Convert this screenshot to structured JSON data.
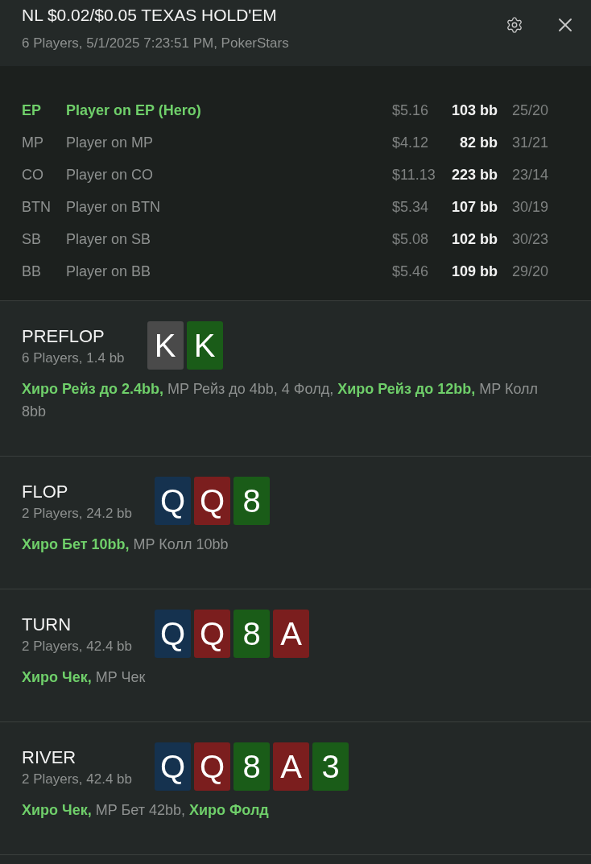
{
  "header": {
    "title": "NL $0.02/$0.05 TEXAS HOLD'EM",
    "subtitle": "6 Players, 5/1/2025 7:23:51 PM, PokerStars"
  },
  "players": [
    {
      "position": "EP",
      "name": "Player on EP (Hero)",
      "stack": "$5.16",
      "stack_bb": "103 bb",
      "stats": "25/20",
      "hero": true
    },
    {
      "position": "MP",
      "name": "Player on MP",
      "stack": "$4.12",
      "stack_bb": "82 bb",
      "stats": "31/21",
      "hero": false
    },
    {
      "position": "CO",
      "name": "Player on CO",
      "stack": "$11.13",
      "stack_bb": "223 bb",
      "stats": "23/14",
      "hero": false
    },
    {
      "position": "BTN",
      "name": "Player on BTN",
      "stack": "$5.34",
      "stack_bb": "107 bb",
      "stats": "30/19",
      "hero": false
    },
    {
      "position": "SB",
      "name": "Player on SB",
      "stack": "$5.08",
      "stack_bb": "102 bb",
      "stats": "30/23",
      "hero": false
    },
    {
      "position": "BB",
      "name": "Player on BB",
      "stack": "$5.46",
      "stack_bb": "109 bb",
      "stats": "29/20",
      "hero": false
    }
  ],
  "streets": [
    {
      "name": "PREFLOP",
      "info": "6 Players, 1.4 bb",
      "cards": [
        {
          "rank": "K",
          "color": "#4a4a4a"
        },
        {
          "rank": "K",
          "color": "#1a5c18"
        }
      ],
      "actions": "**Хиро Рейз до 2.4bb,** MP Рейз до 4bb, 4 Фолд, **Хиро Рейз до 12bb,** MP Колл 8bb"
    },
    {
      "name": "FLOP",
      "info": "2 Players, 24.2 bb",
      "cards": [
        {
          "rank": "Q",
          "color": "#15324f"
        },
        {
          "rank": "Q",
          "color": "#7b1e1e"
        },
        {
          "rank": "8",
          "color": "#1a5c18"
        }
      ],
      "actions": "**Хиро Бет 10bb,** MP Колл 10bb"
    },
    {
      "name": "TURN",
      "info": "2 Players, 42.4 bb",
      "cards": [
        {
          "rank": "Q",
          "color": "#15324f"
        },
        {
          "rank": "Q",
          "color": "#7b1e1e"
        },
        {
          "rank": "8",
          "color": "#1a5c18"
        },
        {
          "rank": "A",
          "color": "#7b1e1e"
        }
      ],
      "actions": "**Хиро Чек,** MP Чек"
    },
    {
      "name": "RIVER",
      "info": "2 Players, 42.4 bb",
      "cards": [
        {
          "rank": "Q",
          "color": "#15324f"
        },
        {
          "rank": "Q",
          "color": "#7b1e1e"
        },
        {
          "rank": "8",
          "color": "#1a5c18"
        },
        {
          "rank": "A",
          "color": "#7b1e1e"
        },
        {
          "rank": "3",
          "color": "#1a5c18"
        }
      ],
      "actions": "**Хиро Чек,** MP Бет 42bb, **Хиро Фолд**"
    }
  ]
}
